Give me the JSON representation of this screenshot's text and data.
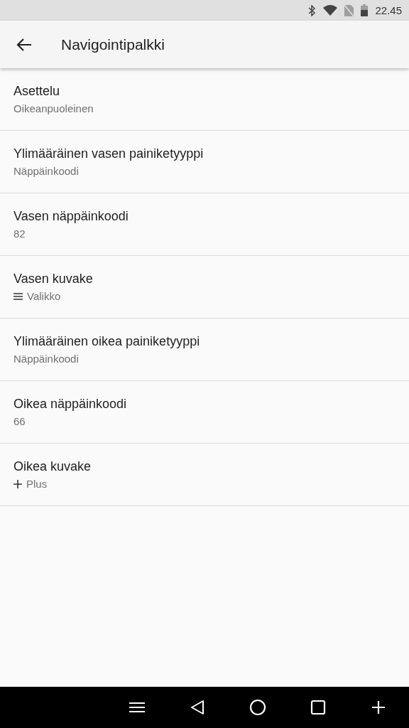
{
  "status_bar": {
    "time": "22.45"
  },
  "app_bar": {
    "title": "Navigointipalkki"
  },
  "settings": [
    {
      "kind": "plain",
      "title": "Asettelu",
      "summary": "Oikeanpuoleinen"
    },
    {
      "kind": "plain",
      "title": "Ylimääräinen vasen painiketyyppi",
      "summary": "Näppäinkoodi"
    },
    {
      "kind": "plain",
      "title": "Vasen näppäinkoodi",
      "summary": "82"
    },
    {
      "kind": "menu",
      "title": "Vasen kuvake",
      "summary": "Valikko"
    },
    {
      "kind": "plain",
      "title": "Ylimääräinen oikea painiketyyppi",
      "summary": "Näppäinkoodi"
    },
    {
      "kind": "plain",
      "title": "Oikea näppäinkoodi",
      "summary": "66"
    },
    {
      "kind": "plus",
      "title": "Oikea kuvake",
      "summary": "Plus"
    }
  ]
}
